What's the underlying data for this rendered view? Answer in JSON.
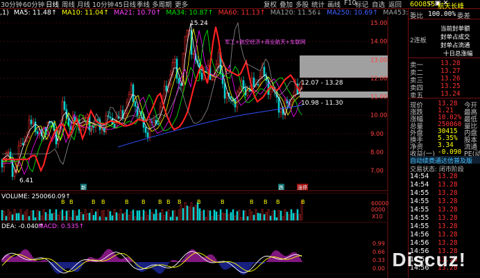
{
  "toolbar": {
    "tabs": [
      "30分钟",
      "60分钟",
      "日线",
      "周线",
      "月线",
      "10分钟",
      "45日线",
      "季线",
      "多周期",
      "更多"
    ],
    "right_tools": [
      "复权",
      "叠加",
      "多股",
      "统计",
      "画线",
      "F10",
      "标记",
      "自选",
      "返回"
    ]
  },
  "ma_bar": {
    "prefix": ",1)",
    "ma5": "MA5: 11.48↑",
    "ma10": "MA10: 11.04↑",
    "ma21": "MA21: 10.70↑",
    "ma34": "MA34: 10.87↑",
    "ma60": "MA60: 11.13↑",
    "ma120": "MA120: 11.56↓",
    "ma250": "MA250: 10.69↑",
    "ma453": "MA453: -"
  },
  "price_chart": {
    "yticks": [
      "15.00",
      "14.00",
      "13.00",
      "12.00",
      "11.00",
      "10.00",
      "9.00",
      "8.00",
      "7.00"
    ],
    "high_label": "15.24",
    "low_label": "6.41",
    "annotation": "军工+航空经济+商业航天+车联网",
    "box1_label": "12.07 - 13.28",
    "box2_label": "10.98 - 11.30",
    "marker_left": "新",
    "marker_mid": "跌",
    "marker_right": "涨停"
  },
  "volume": {
    "label": "VOLUME: 250060.09↑",
    "yticks": [
      "60000",
      "0000",
      "X10"
    ]
  },
  "macd": {
    "label_dea": "DEA: -0.040↑",
    "label_macd": "MACD: 0.535↑",
    "yticks": [
      "0.99",
      "0.66",
      "0.33",
      "0.00"
    ]
  },
  "quote": {
    "code": "600855",
    "name": "航天长峰",
    "weibi_label": "委比",
    "weibi_value": "100.00%",
    "weicha_label": "委差",
    "board": "2连板",
    "seal_lines": [
      "当前封单额",
      "封单占成交",
      "封单占流通",
      "十日总涨幅"
    ],
    "sells": [
      {
        "label": "卖一",
        "price": "13.28"
      },
      {
        "label": "卖二",
        "price": "13.27"
      },
      {
        "label": "卖三",
        "price": "13.26"
      },
      {
        "label": "卖四",
        "price": "13.25"
      },
      {
        "label": "卖五",
        "price": "13.24"
      }
    ],
    "stats": [
      {
        "label": "现价",
        "value": "13.28",
        "label2": "今开"
      },
      {
        "label": "涨跌",
        "value": "1.21",
        "label2": "最高"
      },
      {
        "label": "涨幅",
        "value": "10.02%",
        "label2": "最低"
      },
      {
        "label": "总量",
        "value": "250060",
        "label2": "量比"
      },
      {
        "label": "外盘",
        "value": "30415",
        "label2": "内盘"
      },
      {
        "label": "换手",
        "value": "5.35%",
        "label2": "股本"
      },
      {
        "label": "净资",
        "value": "3.34",
        "label2": "流通"
      },
      {
        "label": "收益(一)",
        "value": "-0.090",
        "label2": "PE(动)"
      }
    ],
    "banner1": "自动续费通达信普及版",
    "banner2": "交易状态: 闭市阶段",
    "ticks": [
      {
        "time": "14:54",
        "price": "13.28"
      },
      {
        "time": "14:54",
        "price": "13.28"
      },
      {
        "time": "14:55",
        "price": "13.28"
      },
      {
        "time": "14:55",
        "price": "13.28"
      },
      {
        "time": "14:55",
        "price": "13.28"
      },
      {
        "time": "14:55",
        "price": "13.28"
      },
      {
        "time": "14:55",
        "price": "13.28"
      },
      {
        "time": "14:56",
        "price": "13.28"
      },
      {
        "time": "14:56",
        "price": "13.28"
      },
      {
        "time": "14:56",
        "price": "13.28"
      },
      {
        "time": "14:56",
        "price": "13.28"
      },
      {
        "time": "14:56",
        "price": "13.28"
      }
    ]
  },
  "watermark": "Discuz!",
  "colors": {
    "up": "#ff3030",
    "down": "#00e0e0",
    "ma5": "#ffffff",
    "ma10": "#ffff00",
    "ma21": "#ff00ff",
    "ma34": "#00ff00",
    "ma60": "#ff2020",
    "ma250": "#3050ff"
  }
}
